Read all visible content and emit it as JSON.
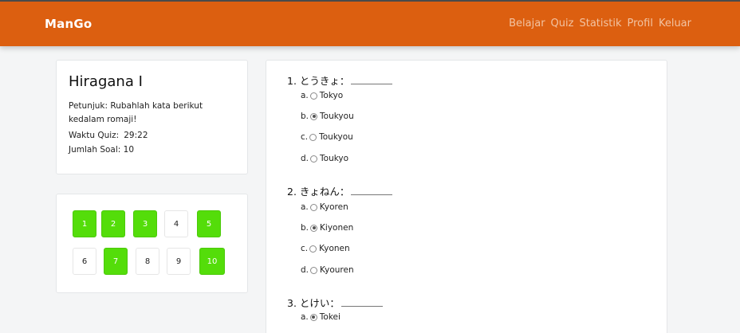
{
  "app": {
    "brand": "ManGo"
  },
  "nav": {
    "links": [
      "Belajar",
      "Quiz",
      "Statistik",
      "Profil",
      "Keluar"
    ],
    "link_color": "#f2c3a2",
    "bar_color": "#dc5f10"
  },
  "quiz_info": {
    "title": "Hiragana I",
    "instructions": "Petunjuk: Rubahlah kata berikut kedalam romaji!",
    "timer_label": "Waktu Quiz:",
    "timer_value": "29:22",
    "count_label": "Jumlah Soal: 10"
  },
  "question_nav": {
    "answered_color": "#54dd0a",
    "items": [
      {
        "label": "1",
        "answered": true
      },
      {
        "label": "2",
        "answered": true
      },
      {
        "label": "3",
        "answered": true
      },
      {
        "label": "4",
        "answered": false
      },
      {
        "label": "5",
        "answered": true
      },
      {
        "label": "6",
        "answered": false
      },
      {
        "label": "7",
        "answered": true
      },
      {
        "label": "8",
        "answered": false
      },
      {
        "label": "9",
        "answered": false
      },
      {
        "label": "10",
        "answered": true
      }
    ]
  },
  "questions": [
    {
      "prompt": "1. とうきょ：",
      "options": [
        {
          "letter": "a.",
          "text": "Tokyo",
          "checked": false
        },
        {
          "letter": "b.",
          "text": "Toukyou",
          "checked": true
        },
        {
          "letter": "c.",
          "text": "Toukyou",
          "checked": false
        },
        {
          "letter": "d.",
          "text": "Toukyo",
          "checked": false
        }
      ]
    },
    {
      "prompt": "2. きょねん：",
      "options": [
        {
          "letter": "a.",
          "text": "Kyoren",
          "checked": false
        },
        {
          "letter": "b.",
          "text": "Kiyonen",
          "checked": true
        },
        {
          "letter": "c.",
          "text": "Kyonen",
          "checked": false
        },
        {
          "letter": "d.",
          "text": "Kyouren",
          "checked": false
        }
      ]
    },
    {
      "prompt": "3. とけい：",
      "options": [
        {
          "letter": "a.",
          "text": "Tokei",
          "checked": true
        }
      ]
    }
  ]
}
